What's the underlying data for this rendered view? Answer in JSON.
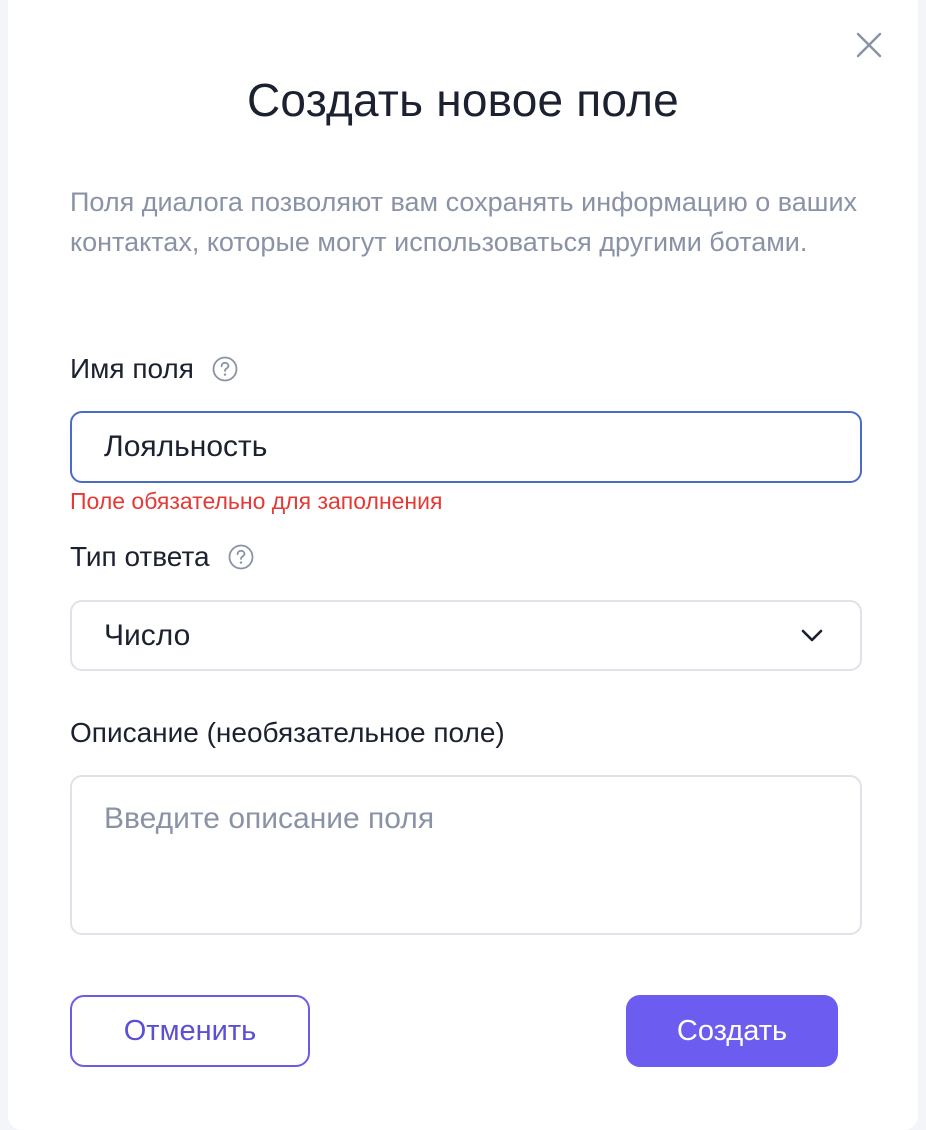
{
  "modal": {
    "title": "Создать новое поле",
    "description": "Поля диалога позволяют вам сохранять информацию о ваших контактах, которые могут использоваться другими ботами.",
    "close_icon": "close-icon"
  },
  "field_name": {
    "label": "Имя поля",
    "value": "Лояльность",
    "error": "Поле обязательно для заполнения",
    "help_icon": "question-circle-icon"
  },
  "answer_type": {
    "label": "Тип ответа",
    "selected": "Число",
    "help_icon": "question-circle-icon",
    "dropdown_icon": "chevron-down-icon"
  },
  "description_field": {
    "label": "Описание (необязательное поле)",
    "placeholder": "Введите описание поля",
    "value": ""
  },
  "buttons": {
    "cancel": "Отменить",
    "create": "Создать"
  },
  "colors": {
    "accent": "#6c5cf0",
    "focus_border": "#4a6bc8",
    "error": "#e53935",
    "muted_text": "#8a93a6",
    "text": "#1c2130"
  }
}
